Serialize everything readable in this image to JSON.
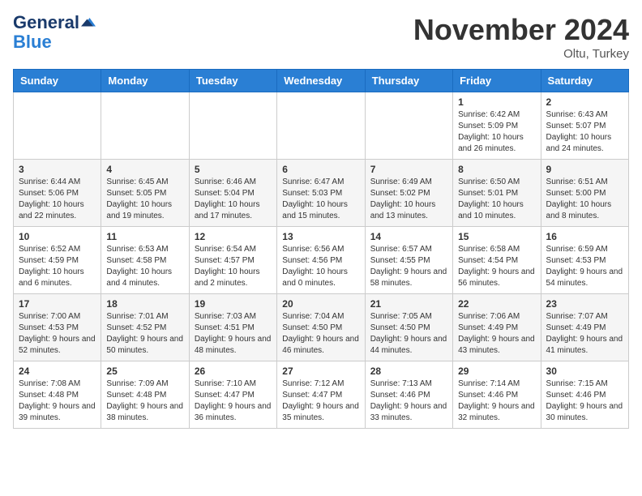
{
  "header": {
    "logo_general": "General",
    "logo_blue": "Blue",
    "month_title": "November 2024",
    "location": "Oltu, Turkey"
  },
  "calendar": {
    "days_of_week": [
      "Sunday",
      "Monday",
      "Tuesday",
      "Wednesday",
      "Thursday",
      "Friday",
      "Saturday"
    ],
    "weeks": [
      [
        {
          "day": "",
          "info": ""
        },
        {
          "day": "",
          "info": ""
        },
        {
          "day": "",
          "info": ""
        },
        {
          "day": "",
          "info": ""
        },
        {
          "day": "",
          "info": ""
        },
        {
          "day": "1",
          "info": "Sunrise: 6:42 AM\nSunset: 5:09 PM\nDaylight: 10 hours and 26 minutes."
        },
        {
          "day": "2",
          "info": "Sunrise: 6:43 AM\nSunset: 5:07 PM\nDaylight: 10 hours and 24 minutes."
        }
      ],
      [
        {
          "day": "3",
          "info": "Sunrise: 6:44 AM\nSunset: 5:06 PM\nDaylight: 10 hours and 22 minutes."
        },
        {
          "day": "4",
          "info": "Sunrise: 6:45 AM\nSunset: 5:05 PM\nDaylight: 10 hours and 19 minutes."
        },
        {
          "day": "5",
          "info": "Sunrise: 6:46 AM\nSunset: 5:04 PM\nDaylight: 10 hours and 17 minutes."
        },
        {
          "day": "6",
          "info": "Sunrise: 6:47 AM\nSunset: 5:03 PM\nDaylight: 10 hours and 15 minutes."
        },
        {
          "day": "7",
          "info": "Sunrise: 6:49 AM\nSunset: 5:02 PM\nDaylight: 10 hours and 13 minutes."
        },
        {
          "day": "8",
          "info": "Sunrise: 6:50 AM\nSunset: 5:01 PM\nDaylight: 10 hours and 10 minutes."
        },
        {
          "day": "9",
          "info": "Sunrise: 6:51 AM\nSunset: 5:00 PM\nDaylight: 10 hours and 8 minutes."
        }
      ],
      [
        {
          "day": "10",
          "info": "Sunrise: 6:52 AM\nSunset: 4:59 PM\nDaylight: 10 hours and 6 minutes."
        },
        {
          "day": "11",
          "info": "Sunrise: 6:53 AM\nSunset: 4:58 PM\nDaylight: 10 hours and 4 minutes."
        },
        {
          "day": "12",
          "info": "Sunrise: 6:54 AM\nSunset: 4:57 PM\nDaylight: 10 hours and 2 minutes."
        },
        {
          "day": "13",
          "info": "Sunrise: 6:56 AM\nSunset: 4:56 PM\nDaylight: 10 hours and 0 minutes."
        },
        {
          "day": "14",
          "info": "Sunrise: 6:57 AM\nSunset: 4:55 PM\nDaylight: 9 hours and 58 minutes."
        },
        {
          "day": "15",
          "info": "Sunrise: 6:58 AM\nSunset: 4:54 PM\nDaylight: 9 hours and 56 minutes."
        },
        {
          "day": "16",
          "info": "Sunrise: 6:59 AM\nSunset: 4:53 PM\nDaylight: 9 hours and 54 minutes."
        }
      ],
      [
        {
          "day": "17",
          "info": "Sunrise: 7:00 AM\nSunset: 4:53 PM\nDaylight: 9 hours and 52 minutes."
        },
        {
          "day": "18",
          "info": "Sunrise: 7:01 AM\nSunset: 4:52 PM\nDaylight: 9 hours and 50 minutes."
        },
        {
          "day": "19",
          "info": "Sunrise: 7:03 AM\nSunset: 4:51 PM\nDaylight: 9 hours and 48 minutes."
        },
        {
          "day": "20",
          "info": "Sunrise: 7:04 AM\nSunset: 4:50 PM\nDaylight: 9 hours and 46 minutes."
        },
        {
          "day": "21",
          "info": "Sunrise: 7:05 AM\nSunset: 4:50 PM\nDaylight: 9 hours and 44 minutes."
        },
        {
          "day": "22",
          "info": "Sunrise: 7:06 AM\nSunset: 4:49 PM\nDaylight: 9 hours and 43 minutes."
        },
        {
          "day": "23",
          "info": "Sunrise: 7:07 AM\nSunset: 4:49 PM\nDaylight: 9 hours and 41 minutes."
        }
      ],
      [
        {
          "day": "24",
          "info": "Sunrise: 7:08 AM\nSunset: 4:48 PM\nDaylight: 9 hours and 39 minutes."
        },
        {
          "day": "25",
          "info": "Sunrise: 7:09 AM\nSunset: 4:48 PM\nDaylight: 9 hours and 38 minutes."
        },
        {
          "day": "26",
          "info": "Sunrise: 7:10 AM\nSunset: 4:47 PM\nDaylight: 9 hours and 36 minutes."
        },
        {
          "day": "27",
          "info": "Sunrise: 7:12 AM\nSunset: 4:47 PM\nDaylight: 9 hours and 35 minutes."
        },
        {
          "day": "28",
          "info": "Sunrise: 7:13 AM\nSunset: 4:46 PM\nDaylight: 9 hours and 33 minutes."
        },
        {
          "day": "29",
          "info": "Sunrise: 7:14 AM\nSunset: 4:46 PM\nDaylight: 9 hours and 32 minutes."
        },
        {
          "day": "30",
          "info": "Sunrise: 7:15 AM\nSunset: 4:46 PM\nDaylight: 9 hours and 30 minutes."
        }
      ]
    ]
  }
}
